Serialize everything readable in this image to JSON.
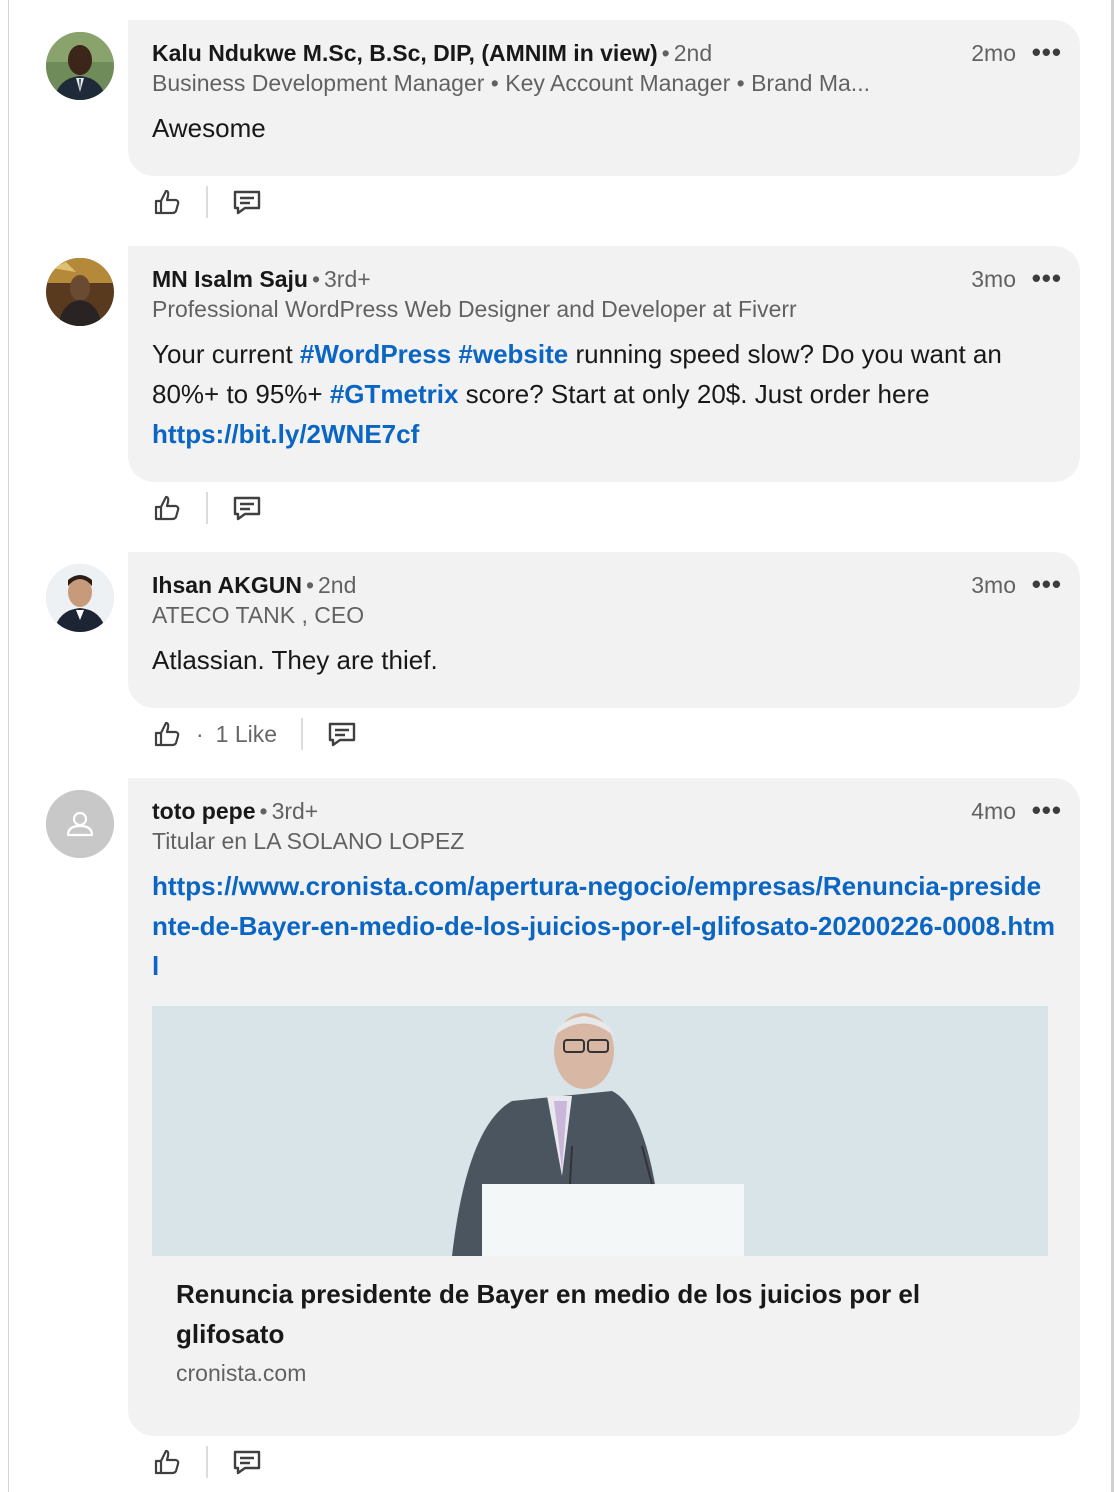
{
  "comments": [
    {
      "name": "Kalu Ndukwe M.Sc, B.Sc, DIP, (AMNIM in view)",
      "degree": "2nd",
      "headline": "Business Development Manager • Key Account Manager • Brand Ma...",
      "time": "2mo",
      "text": "Awesome",
      "avatar": "avatar-photo"
    },
    {
      "name": "MN Isalm Saju",
      "degree": "3rd+",
      "headline": "Professional WordPress Web Designer and Developer at Fiverr",
      "time": "3mo",
      "text_parts": [
        "Your current ",
        "#WordPress",
        " ",
        "#website",
        " running speed slow? Do you want an 80%+ to 95%+ ",
        "#GTmetrix",
        " score? Start at only 20$. Just order here  ",
        "https://bit.ly/2WNE7cf"
      ],
      "avatar": "avatar-photo"
    },
    {
      "name": "Ihsan AKGUN",
      "degree": "2nd",
      "headline": "ATECO TANK , CEO",
      "time": "3mo",
      "text": "Atlassian. They are thief.",
      "likes": "1 Like",
      "avatar": "avatar-photo"
    },
    {
      "name": "toto pepe",
      "degree": "3rd+",
      "headline": "Titular en LA SOLANO LOPEZ",
      "time": "4mo",
      "link": "https://www.cronista.com/apertura-negocio/empresas/Renuncia-presidente-de-Bayer-en-medio-de-los-juicios-por-el-glifosato-20200226-0008.html",
      "avatar": "avatar-placeholder-icon",
      "preview": {
        "title": "Renuncia presidente de Bayer en medio de los juicios por el glifosato",
        "source": "cronista.com"
      }
    }
  ],
  "ui": {
    "dot": "•",
    "more": "•••",
    "likes_dot": "·"
  },
  "colors": {
    "link": "#0a66c2",
    "bubble": "#f2f2f2"
  }
}
